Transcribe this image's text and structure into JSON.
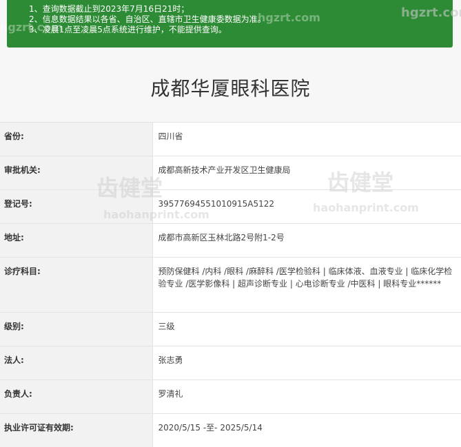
{
  "notice": {
    "lines": [
      "1、查询数据截止到2023年7月16日21时；",
      "2、信息数据结果以各省、自治区、直辖市卫生健康委数据为准。",
      "3、凌晨1点至凌晨5点系统进行维护，不能提供查询。"
    ]
  },
  "title": "成都华厦眼科医院",
  "rows": [
    {
      "label": "省份:",
      "value": "四川省"
    },
    {
      "label": "审批机关:",
      "value": "成都高新技术产业开发区卫生健康局"
    },
    {
      "label": "登记号:",
      "value": "39577694551010915A5122"
    },
    {
      "label": "地址:",
      "value": "成都市高新区玉林北路2号附1-2号"
    },
    {
      "label": "诊疗科目:",
      "value": "预防保健科 /内科 /眼科 /麻醉科 /医学检验科 | 临床体液、血液专业 | 临床化学检验专业 /医学影像科 | 超声诊断专业 | 心电诊断专业 /中医科 | 眼科专业******"
    },
    {
      "label": "级别:",
      "value": "三级"
    },
    {
      "label": "法人:",
      "value": "张志勇"
    },
    {
      "label": "负责人:",
      "value": "罗清礼"
    },
    {
      "label": "执业许可证有效期:",
      "value": "2020/5/15 -至- 2025/5/14"
    }
  ],
  "watermark": {
    "top_left": "hgzrt.com",
    "top_right": "hgzrt.com",
    "logo_text": "齿健堂",
    "url": "haohanprint.com"
  }
}
